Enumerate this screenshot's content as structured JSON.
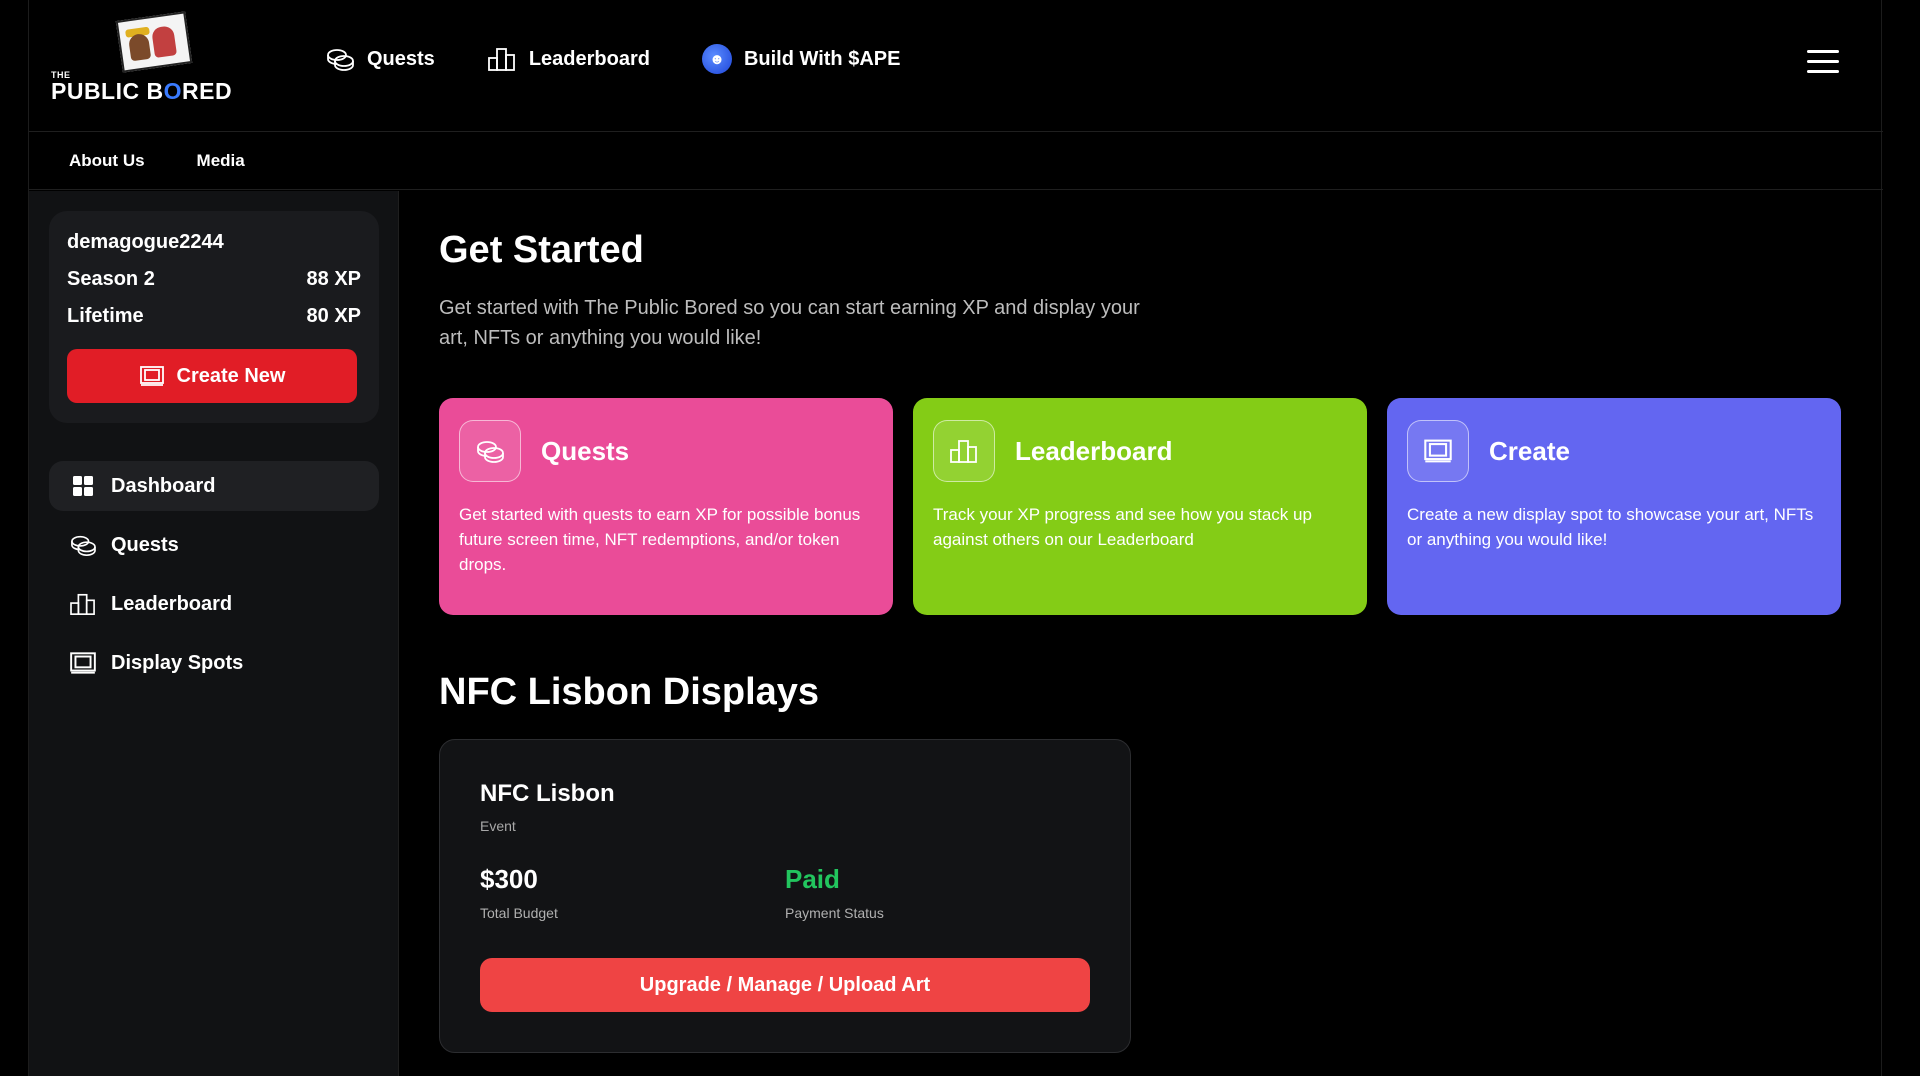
{
  "brand": {
    "prefix": "THE",
    "name_part1": "PUBLIC B",
    "name_o": "O",
    "name_part2": "RED"
  },
  "topnav": [
    {
      "label": "Quests",
      "icon": "coins-icon"
    },
    {
      "label": "Leaderboard",
      "icon": "leaderboard-icon"
    },
    {
      "label": "Build With $APE",
      "icon": "ape-coin-icon"
    }
  ],
  "subnav": [
    {
      "label": "About Us"
    },
    {
      "label": "Media"
    }
  ],
  "profile": {
    "username": "demagogue2244",
    "season_label": "Season 2",
    "season_xp": "88 XP",
    "lifetime_label": "Lifetime",
    "lifetime_xp": "80 XP",
    "create_button": "Create New"
  },
  "sidebar_menu": [
    {
      "label": "Dashboard",
      "icon": "dashboard-icon",
      "active": true
    },
    {
      "label": "Quests",
      "icon": "coins-icon"
    },
    {
      "label": "Leaderboard",
      "icon": "leaderboard-icon"
    },
    {
      "label": "Display Spots",
      "icon": "display-icon"
    }
  ],
  "main": {
    "title": "Get Started",
    "intro": "Get started with The Public Bored so you can start earning XP and display your art, NFTs or anything you would like!",
    "cards": [
      {
        "title": "Quests",
        "desc": "Get started with quests to earn XP for possible bonus future screen time, NFT redemptions, and/or token drops.",
        "color": "#ea4c98",
        "icon": "coins-icon"
      },
      {
        "title": "Leaderboard",
        "desc": "Track your XP progress and see how you stack up against others on our Leaderboard",
        "color": "#84cc16",
        "icon": "leaderboard-icon"
      },
      {
        "title": "Create",
        "desc": "Create a new display spot to showcase your art, NFTs or anything you would like!",
        "color": "#6366f1",
        "icon": "display-icon"
      }
    ],
    "section_title": "NFC Lisbon Displays",
    "display": {
      "name": "NFC Lisbon",
      "type": "Event",
      "budget_value": "$300",
      "budget_label": "Total Budget",
      "status_value": "Paid",
      "status_label": "Payment Status",
      "action_button": "Upgrade / Manage / Upload Art"
    }
  },
  "colors": {
    "accent_red": "#e11d26",
    "paid_green": "#22c55e"
  }
}
